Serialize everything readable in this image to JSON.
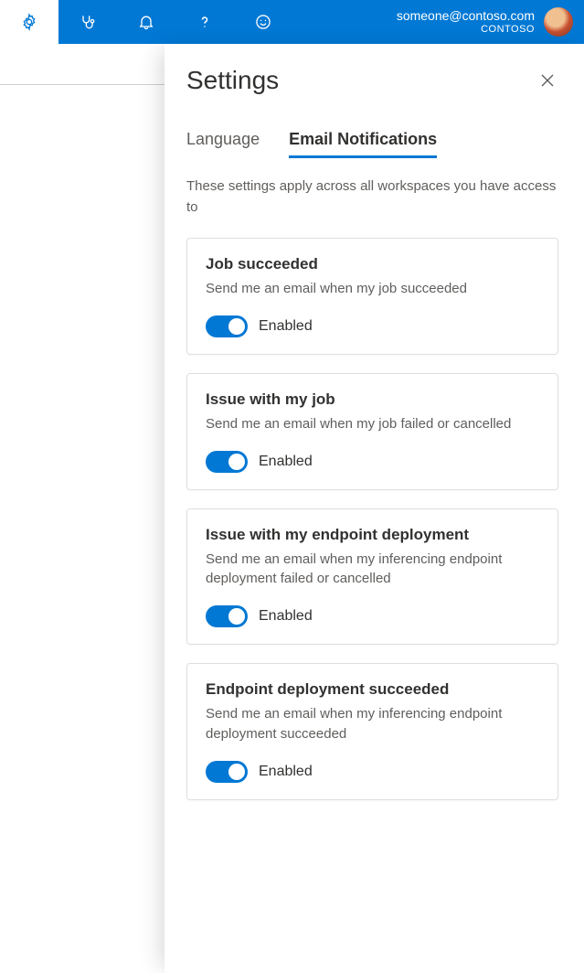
{
  "header": {
    "email": "someone@contoso.com",
    "org": "CONTOSO"
  },
  "panel": {
    "title": "Settings",
    "tabs": {
      "language": "Language",
      "email_notifications": "Email Notifications"
    },
    "description": "These settings apply across all workspaces you have access to",
    "toggle_state_label": "Enabled"
  },
  "cards": [
    {
      "title": "Job succeeded",
      "desc": "Send me an email when my job succeeded"
    },
    {
      "title": "Issue with my job",
      "desc": "Send me an email when my job failed or cancelled"
    },
    {
      "title": "Issue with my endpoint deployment",
      "desc": "Send me an email when my inferencing endpoint deployment failed or cancelled"
    },
    {
      "title": "Endpoint deployment succeeded",
      "desc": "Send me an email when my inferencing endpoint deployment succeeded"
    }
  ]
}
